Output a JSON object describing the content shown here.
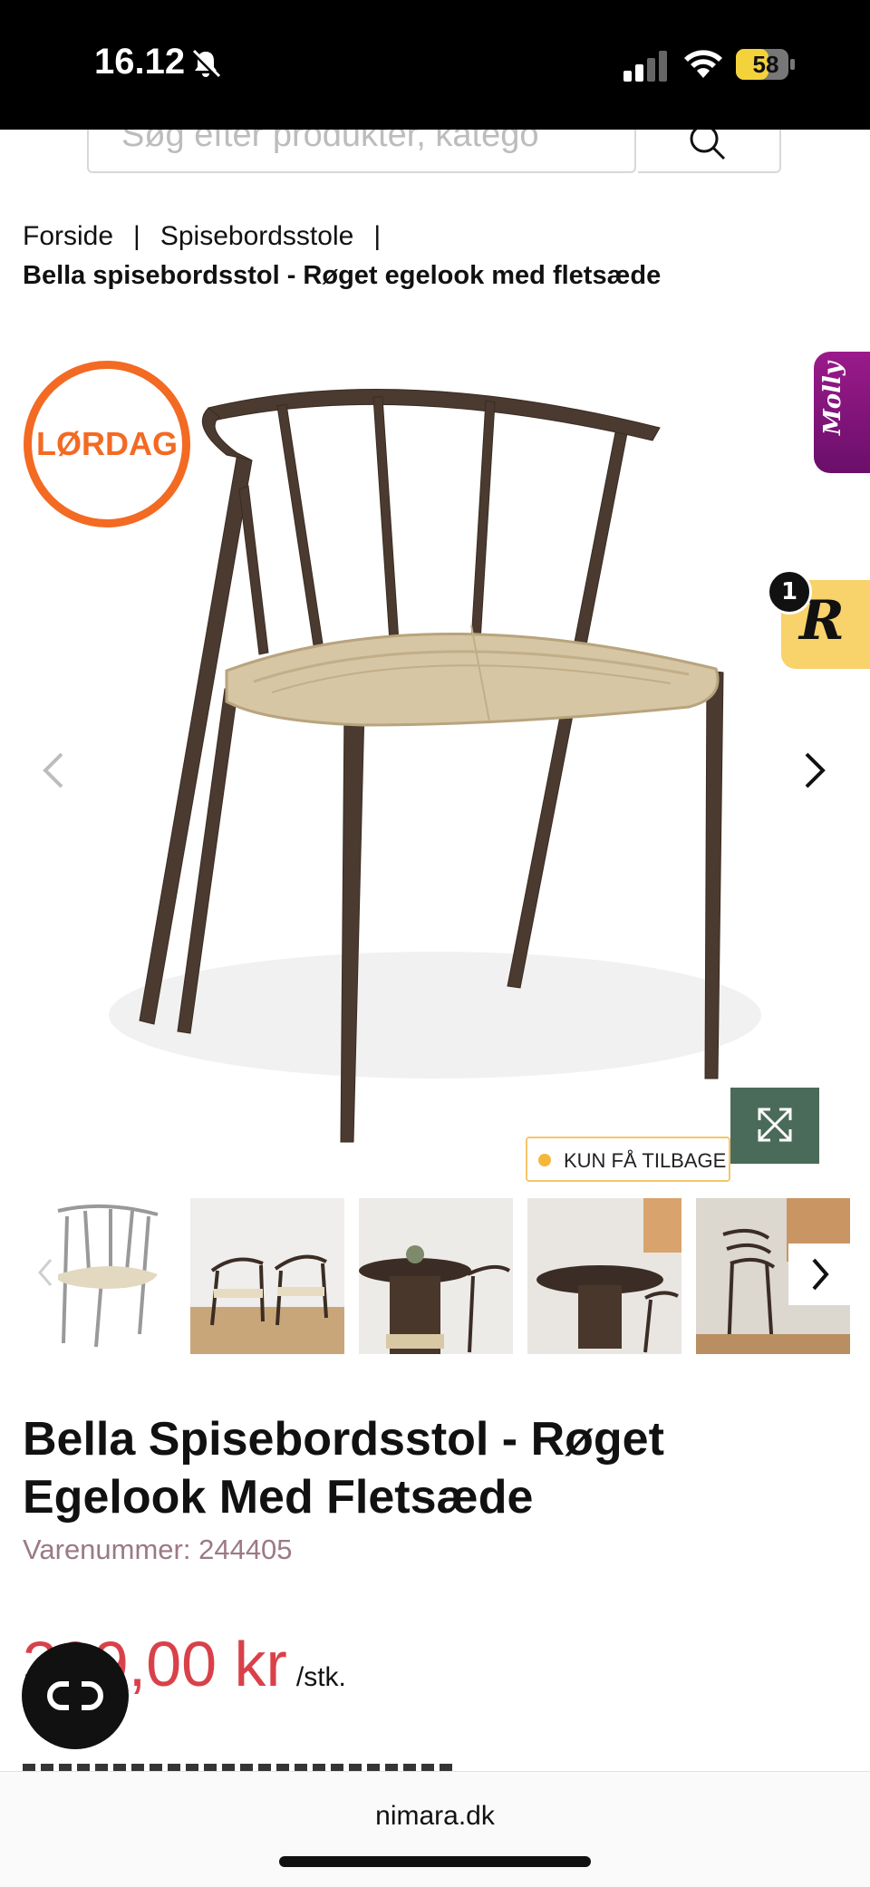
{
  "status_bar": {
    "time": "16.12",
    "battery": "58"
  },
  "search": {
    "placeholder": "Søg efter produkter, katego"
  },
  "breadcrumb": {
    "items": [
      "Forside",
      "Spisebordsstole"
    ],
    "separator": "|",
    "current": "Bella spisebordsstol - Røget egelook med fletsæde"
  },
  "gallery": {
    "badge": "LØRDAG",
    "stock_tag": "KUN FÅ TILBAGE",
    "side_widgets": {
      "molly": "Molly",
      "reviews_letter": "R",
      "reviews_count": "1"
    }
  },
  "product": {
    "title": "Bella Spisebordsstol - Røget Egelook Med Fletsæde",
    "sku_label": "Varenummer: 244405",
    "price": "399,00 kr",
    "price_unit": "/stk."
  },
  "browser": {
    "domain": "nimara.dk"
  },
  "colors": {
    "accent_orange": "#f36a23",
    "price_red": "#d9414a",
    "expand_green": "#4b6b5a",
    "molly_purple": "#8a1580",
    "review_yellow": "#f8d26a"
  }
}
